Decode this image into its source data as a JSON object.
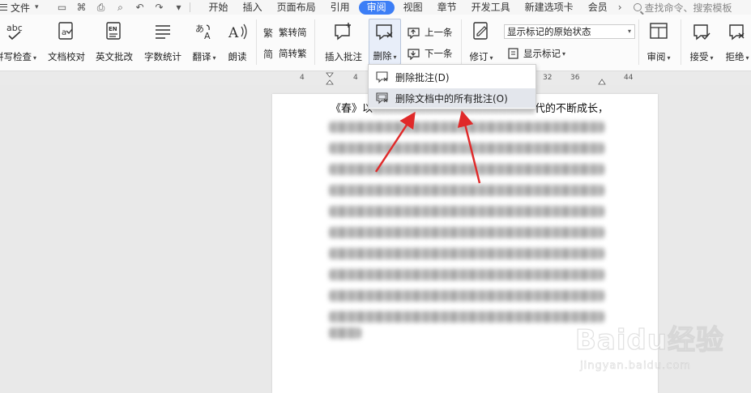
{
  "menubar": {
    "file_label": "文件",
    "tabs": [
      "开始",
      "插入",
      "页面布局",
      "引用",
      "审阅",
      "视图",
      "章节",
      "开发工具",
      "新建选项卡",
      "会员"
    ],
    "active_tab": "审阅",
    "search_placeholder": "查找命令、搜索模板"
  },
  "ribbon": {
    "spell_check": "拼写检查",
    "doc_proofread": "文档校对",
    "english_correct": "英文批改",
    "word_count": "字数统计",
    "translate": "翻译",
    "read_aloud": "朗读",
    "trad_to_simp": "繁转简",
    "simp_to_trad": "简转繁",
    "insert_comment": "插入批注",
    "delete": "删除",
    "prev_item": "上一条",
    "next_item": "下一条",
    "track_changes": "修订",
    "display_mode_value": "显示标记的原始状态",
    "show_markup": "显示标记",
    "review": "审阅",
    "accept": "接受",
    "reject": "拒绝",
    "abc_label": "abc",
    "en_label": "EN"
  },
  "ruler": {
    "ticks": [
      "4",
      "4",
      "32",
      "36",
      "44"
    ]
  },
  "dropdown": {
    "items": [
      {
        "label": "删除批注(D)"
      },
      {
        "label": "删除文档中的所有批注(O)"
      }
    ]
  },
  "document": {
    "first_line_prefix": "《春》以",
    "first_line_suffix": "代的不断成长，"
  },
  "watermark": {
    "brand": "Baidu经验",
    "url": "jingyan.baidu.com"
  },
  "colors": {
    "accent": "#3c7ef6",
    "arrow": "#e02a2a"
  }
}
